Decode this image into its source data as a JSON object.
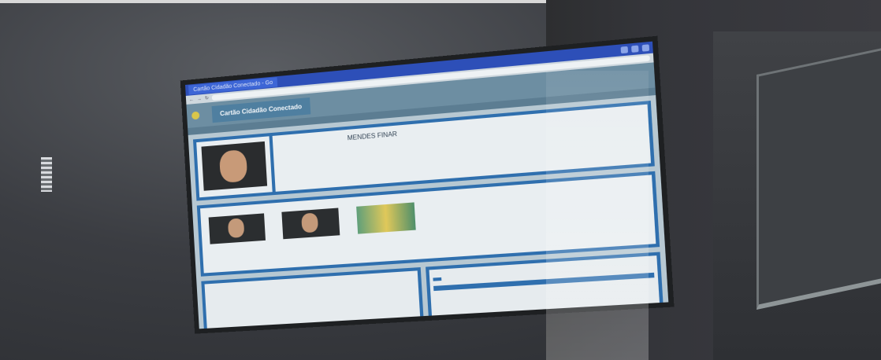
{
  "browser": {
    "tab_title": "Cartão Cidadão Conectado - Go",
    "url": "",
    "window_controls": [
      "minimize-icon",
      "maximize-icon",
      "close-icon"
    ]
  },
  "app": {
    "brand_line1": "",
    "brand_line2": "",
    "title": "Cartão Cidadão Conectado"
  },
  "profile": {
    "name": "MENDES FINAR",
    "fields": []
  },
  "relatives": {
    "label": ""
  },
  "bottom_left": {
    "label": ""
  },
  "bottom_right": {
    "label": "",
    "button": "",
    "column": ""
  },
  "colors": {
    "browser_bar": "#2d4fb8",
    "app_header": "#6d8ea2",
    "panel_border": "#2f6fae"
  }
}
